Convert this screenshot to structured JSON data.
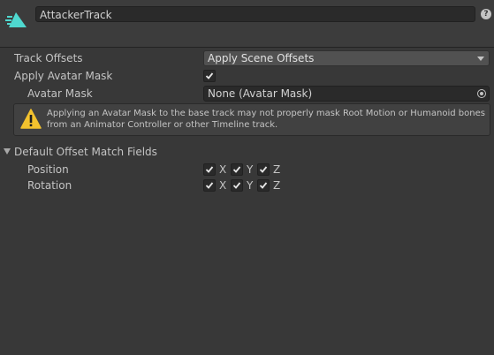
{
  "header": {
    "track_name": "AttackerTrack",
    "track_icon": "animation-track-icon",
    "help_icon": "help-icon",
    "help_glyph": "?"
  },
  "track_offsets": {
    "label": "Track Offsets",
    "value": "Apply Scene Offsets"
  },
  "apply_avatar_mask": {
    "label": "Apply Avatar Mask",
    "checked": true
  },
  "avatar_mask": {
    "label": "Avatar Mask",
    "value": "None (Avatar Mask)"
  },
  "warning": {
    "icon": "warning-icon",
    "text": "Applying an Avatar Mask to the base track may not properly mask Root Motion or Humanoid bones from an Animator Controller or other Timeline track."
  },
  "offset_match_fields": {
    "label": "Default Offset Match Fields",
    "expanded": true,
    "position": {
      "label": "Position",
      "axes": [
        {
          "name": "X",
          "checked": true
        },
        {
          "name": "Y",
          "checked": true
        },
        {
          "name": "Z",
          "checked": true
        }
      ]
    },
    "rotation": {
      "label": "Rotation",
      "axes": [
        {
          "name": "X",
          "checked": true
        },
        {
          "name": "Y",
          "checked": true
        },
        {
          "name": "Z",
          "checked": true
        }
      ]
    }
  },
  "colors": {
    "background": "#383838",
    "track_icon_accent": "#4fd9d0",
    "warning_yellow": "#f3c22e"
  }
}
